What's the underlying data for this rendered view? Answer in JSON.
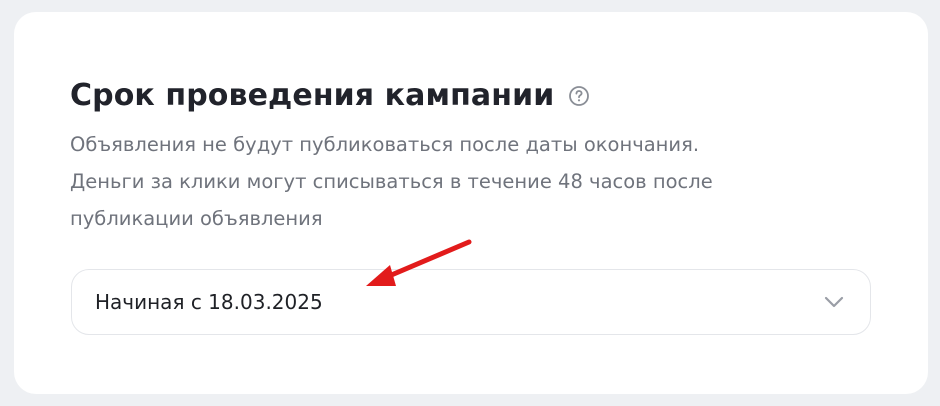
{
  "section": {
    "title": "Срок проведения кампании",
    "description_lines": [
      "Объявления не будут публиковаться после даты окончания.",
      "Деньги за клики могут списываться в течение 48 часов после",
      "публикации объявления"
    ]
  },
  "date_select": {
    "value": "Начиная с 18.03.2025"
  },
  "icons": {
    "help": "help-circle-icon",
    "dropdown": "chevron-down-icon",
    "annotation": "red-arrow-annotation"
  },
  "colors": {
    "annotation_arrow": "#e21b1b",
    "title": "#21232b",
    "description": "#6f737c"
  }
}
